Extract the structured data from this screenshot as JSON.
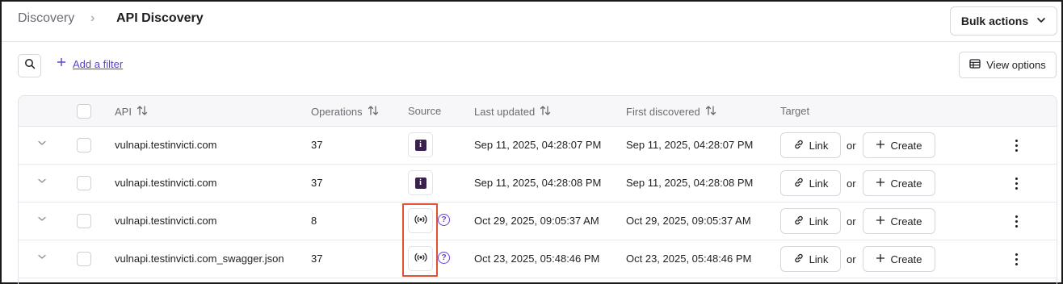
{
  "breadcrumb": {
    "root": "Discovery",
    "separator": "›",
    "current": "API Discovery"
  },
  "header": {
    "bulk_actions_label": "Bulk actions"
  },
  "toolbar": {
    "add_filter_label": "Add a filter",
    "view_options_label": "View options"
  },
  "table": {
    "columns": {
      "api": "API",
      "operations": "Operations",
      "source": "Source",
      "last_updated": "Last updated",
      "first_discovered": "First discovered",
      "target": "Target"
    },
    "rows": [
      {
        "api": "vulnapi.testinvicti.com",
        "operations": "37",
        "source": "invicti",
        "last_updated": "Sep 11, 2025, 04:28:07 PM",
        "first_discovered": "Sep 11, 2025, 04:28:07 PM",
        "link": "Link",
        "or": "or",
        "create": "Create"
      },
      {
        "api": "vulnapi.testinvicti.com",
        "operations": "37",
        "source": "invicti",
        "last_updated": "Sep 11, 2025, 04:28:08 PM",
        "first_discovered": "Sep 11, 2025, 04:28:08 PM",
        "link": "Link",
        "or": "or",
        "create": "Create"
      },
      {
        "api": "vulnapi.testinvicti.com",
        "operations": "8",
        "source": "traffic",
        "last_updated": "Oct 29, 2025, 09:05:37 AM",
        "first_discovered": "Oct 29, 2025, 09:05:37 AM",
        "link": "Link",
        "or": "or",
        "create": "Create"
      },
      {
        "api": "vulnapi.testinvicti.com_swagger.json",
        "operations": "37",
        "source": "traffic",
        "last_updated": "Oct 23, 2025, 05:48:46 PM",
        "first_discovered": "Oct 23, 2025, 05:48:46 PM",
        "link": "Link",
        "or": "or",
        "create": "Create"
      }
    ]
  },
  "icons": {
    "search": "search-icon",
    "add": "plus-icon",
    "view_options": "table-icon",
    "expand": "chevron-down-icon",
    "sort": "sort-icon",
    "source_invicti": "invicti-logo-icon",
    "source_traffic": "broadcast-icon",
    "help": "question-mark-icon",
    "link": "link-icon",
    "create": "plus-icon",
    "more": "more-vertical-icon"
  },
  "colors": {
    "accent": "#5b3fd6",
    "highlight": "#e2522f",
    "invicti_badge": "#3b1f4f"
  },
  "help_glyph": "?",
  "invicti_glyph": "i"
}
